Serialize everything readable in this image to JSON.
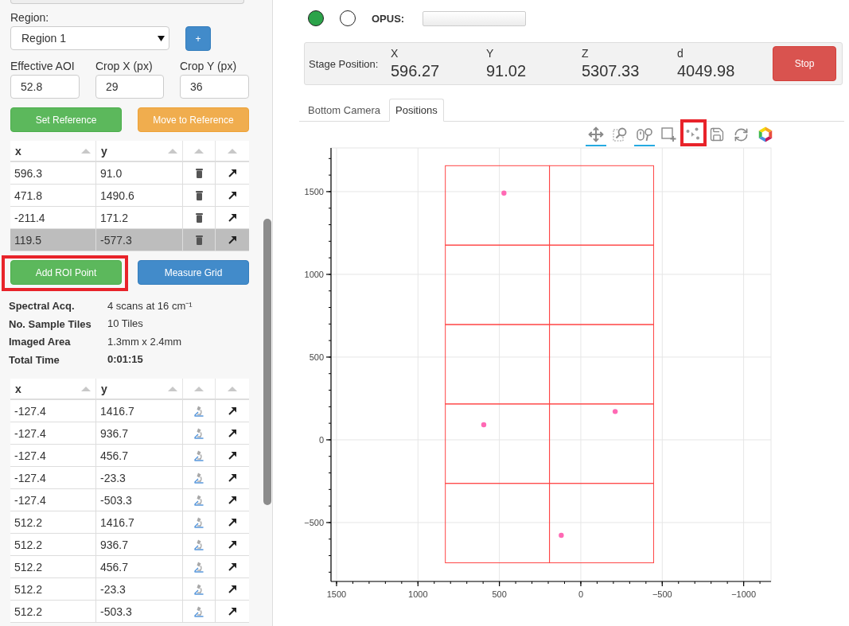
{
  "sidebar": {
    "region": {
      "label": "Region:",
      "value": "Region 1",
      "add_button": "+"
    },
    "crop_fields": [
      {
        "label": "Effective AOI",
        "value": "52.8"
      },
      {
        "label": "Crop X (px)",
        "value": "29"
      },
      {
        "label": "Crop Y (px)",
        "value": "36"
      }
    ],
    "reference_buttons": [
      {
        "label": "Set Reference",
        "kind": "success"
      },
      {
        "label": "Move to Reference",
        "kind": "warning"
      }
    ],
    "roi_table": {
      "columns": [
        "x",
        "y"
      ],
      "row_actions": [
        {
          "kind": "delete"
        },
        {
          "kind": "move"
        }
      ],
      "rows": [
        {
          "cells": [
            "596.3",
            "91.0"
          ],
          "selected": false
        },
        {
          "cells": [
            "471.8",
            "1490.6"
          ],
          "selected": false
        },
        {
          "cells": [
            "-211.4",
            "171.2"
          ],
          "selected": false
        },
        {
          "cells": [
            "119.5",
            "-577.3"
          ],
          "selected": true
        }
      ]
    },
    "roi_buttons": [
      {
        "label": "Add ROI Point",
        "kind": "success",
        "highlighted": true
      },
      {
        "label": "Measure Grid",
        "kind": "primary",
        "highlighted": false
      }
    ],
    "summary": [
      {
        "label": "Spectral Acq.",
        "value": "4 scans at 16 cm⁻¹",
        "bold": false
      },
      {
        "label": "No. Sample Tiles",
        "value": "10 Tiles",
        "bold": false
      },
      {
        "label": "Imaged Area",
        "value": "1.3mm x 2.4mm",
        "bold": false
      },
      {
        "label": "Total Time",
        "value": "0:01:15",
        "bold": true
      }
    ],
    "grid_table": {
      "columns": [
        "x",
        "y"
      ],
      "row_actions": [
        {
          "kind": "measure"
        },
        {
          "kind": "move"
        }
      ],
      "rows": [
        {
          "cells": [
            "-127.4",
            "1416.7"
          ],
          "selected": false
        },
        {
          "cells": [
            "-127.4",
            "936.7"
          ],
          "selected": false
        },
        {
          "cells": [
            "-127.4",
            "456.7"
          ],
          "selected": false
        },
        {
          "cells": [
            "-127.4",
            "-23.3"
          ],
          "selected": false
        },
        {
          "cells": [
            "-127.4",
            "-503.3"
          ],
          "selected": false
        },
        {
          "cells": [
            "512.2",
            "1416.7"
          ],
          "selected": false
        },
        {
          "cells": [
            "512.2",
            "936.7"
          ],
          "selected": false
        },
        {
          "cells": [
            "512.2",
            "456.7"
          ],
          "selected": false
        },
        {
          "cells": [
            "512.2",
            "-23.3"
          ],
          "selected": false
        },
        {
          "cells": [
            "512.2",
            "-503.3"
          ],
          "selected": false
        }
      ]
    }
  },
  "main": {
    "status_lights": [
      {
        "on": true
      },
      {
        "on": false
      }
    ],
    "opus": {
      "label": "OPUS:"
    },
    "stage_position": {
      "label": "Stage Position:",
      "axes": [
        {
          "label": "X",
          "value": "596.27"
        },
        {
          "label": "Y",
          "value": "91.02"
        },
        {
          "label": "Z",
          "value": "5307.33"
        },
        {
          "label": "d",
          "value": "4049.98"
        }
      ],
      "stop_button": "Stop"
    },
    "tabs": [
      {
        "label": "Bottom Camera",
        "selected": false
      },
      {
        "label": "Positions",
        "selected": true
      }
    ],
    "toolbar": [
      {
        "kind": "pan",
        "active": true,
        "highlighted": false
      },
      {
        "kind": "box_zoom",
        "active": false,
        "highlighted": false
      },
      {
        "kind": "wheel_zoom",
        "active": true,
        "highlighted": false
      },
      {
        "kind": "box_edit",
        "active": false,
        "highlighted": false
      },
      {
        "kind": "tap",
        "active": false,
        "highlighted": true
      },
      {
        "kind": "save",
        "active": false,
        "highlighted": false
      },
      {
        "kind": "reset",
        "active": false,
        "highlighted": false
      },
      {
        "kind": "logo",
        "active": false,
        "highlighted": false
      }
    ],
    "plot": {
      "chart_data": {
        "type": "scatter",
        "x": [
          596,
          472,
          -211,
          120
        ],
        "series": [
          {
            "color": "#ff69b4",
            "values": [
              91,
              1491,
              171,
              -577
            ]
          }
        ],
        "xlim": [
          1534,
          -1168
        ],
        "ylim": [
          -856,
          1764
        ],
        "xticks": [
          1500,
          1000,
          500,
          0,
          {
            "value": -500,
            "label": "−500"
          },
          {
            "value": -1000,
            "label": "−1000"
          }
        ],
        "yticks": [
          1500,
          1000,
          500,
          0,
          {
            "value": -500,
            "label": "−500"
          }
        ],
        "grid": true
      }
    }
  }
}
